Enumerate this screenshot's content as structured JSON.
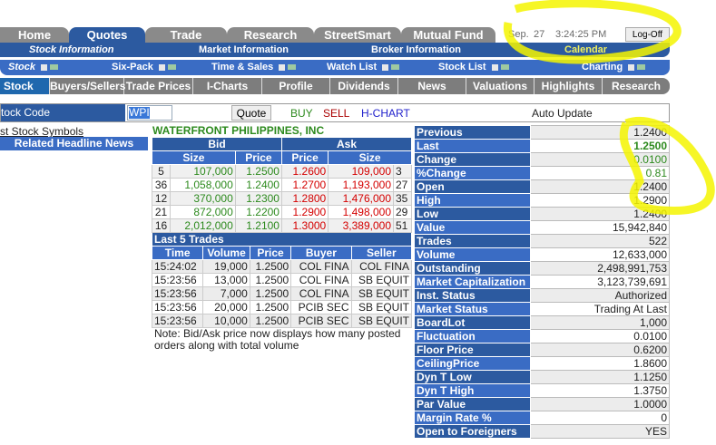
{
  "nav": {
    "tabs": [
      "Home",
      "Quotes",
      "Trade",
      "Research",
      "StreetSmart",
      "Mutual Fund"
    ],
    "date_month": "Sep.",
    "date_day": "27",
    "time": "3:24:25 PM",
    "logoff": "Log-Off"
  },
  "subnav": [
    "Stock Information",
    "Market Information",
    "Broker Information",
    "Calendar"
  ],
  "tools": [
    "Stock",
    "Six-Pack",
    "Time & Sales",
    "Watch List",
    "Stock List",
    "Charting"
  ],
  "stock_tabs": [
    "Stock",
    "Buyers/Sellers",
    "Trade Prices",
    "I-Charts",
    "Profile",
    "Dividends",
    "News",
    "Valuations",
    "Highlights",
    "Research"
  ],
  "code": {
    "label": "tock Code",
    "value": "WPI",
    "quote": "Quote",
    "buy": "BUY",
    "sell": "SELL",
    "hchart": "H-CHART",
    "auto": "Auto Update"
  },
  "left": {
    "link": "st Stock Symbols",
    "news": "Related Headline News"
  },
  "company": "WATERFRONT PHILIPPINES, INC",
  "book": {
    "bid": "Bid",
    "ask": "Ask",
    "size": "Size",
    "price": "Price",
    "rows": [
      [
        "5",
        "107,000",
        "1.2500",
        "1.2600",
        "109,000",
        "3"
      ],
      [
        "36",
        "1,058,000",
        "1.2400",
        "1.2700",
        "1,193,000",
        "27"
      ],
      [
        "12",
        "370,000",
        "1.2300",
        "1.2800",
        "1,476,000",
        "35"
      ],
      [
        "21",
        "872,000",
        "1.2200",
        "1.2900",
        "1,498,000",
        "29"
      ],
      [
        "16",
        "2,012,000",
        "1.2100",
        "1.3000",
        "3,389,000",
        "51"
      ]
    ]
  },
  "trades": {
    "title": "Last 5 Trades",
    "headers": [
      "Time",
      "Volume",
      "Price",
      "Buyer",
      "Seller"
    ],
    "rows": [
      [
        "15:24:02",
        "19,000",
        "1.2500",
        "COL FINA",
        "COL FINA"
      ],
      [
        "15:23:56",
        "13,000",
        "1.2500",
        "COL FINA",
        "SB EQUIT"
      ],
      [
        "15:23:56",
        "7,000",
        "1.2500",
        "COL FINA",
        "SB EQUIT"
      ],
      [
        "15:23:56",
        "20,000",
        "1.2500",
        "PCIB SEC",
        "SB EQUIT"
      ],
      [
        "15:23:56",
        "10,000",
        "1.2500",
        "PCIB SEC",
        "SB EQUIT"
      ]
    ]
  },
  "note": "Note: Bid/Ask price now displays how many posted orders along with total volume",
  "stats": [
    [
      "Previous",
      "1.2400"
    ],
    [
      "Last",
      "1.2500"
    ],
    [
      "Change",
      "0.0100"
    ],
    [
      "%Change",
      "0.81"
    ],
    [
      "Open",
      "1.2400"
    ],
    [
      "High",
      "1.2900"
    ],
    [
      "Low",
      "1.2400"
    ],
    [
      "Value",
      "15,942,840"
    ],
    [
      "Trades",
      "522"
    ],
    [
      "Volume",
      "12,633,000"
    ],
    [
      "Outstanding",
      "2,498,991,753"
    ],
    [
      "Market Capitalization",
      "3,123,739,691"
    ],
    [
      "Inst. Status",
      "Authorized"
    ],
    [
      "Market Status",
      "Trading At Last"
    ],
    [
      "BoardLot",
      "1,000"
    ],
    [
      "Fluctuation",
      "0.0100"
    ],
    [
      "Floor Price",
      "0.6200"
    ],
    [
      "CeilingPrice",
      "1.8600"
    ],
    [
      "Dyn T Low",
      "1.1250"
    ],
    [
      "Dyn T High",
      "1.3750"
    ],
    [
      "Par Value",
      "1.0000"
    ],
    [
      "Margin Rate %",
      "0"
    ],
    [
      "Open to Foreigners",
      "YES"
    ]
  ],
  "colors": {
    "blue": "#2c5aa0",
    "highlight": "#ffff00"
  }
}
